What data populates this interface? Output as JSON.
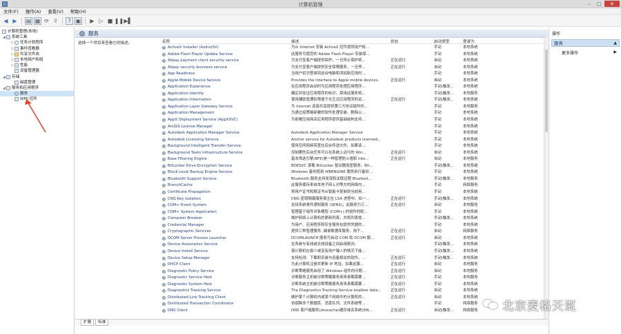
{
  "window": {
    "title": "计算机管理"
  },
  "menu": [
    "文件(F)",
    "操作(A)",
    "查看(V)",
    "帮助(H)"
  ],
  "tree": [
    {
      "label": "计算机管理(本地)",
      "level": 0,
      "icon": "computer-icon"
    },
    {
      "label": "系统工具",
      "level": 1,
      "icon": "tools-icon"
    },
    {
      "label": "任务计划程序",
      "level": 2,
      "icon": "clock-icon"
    },
    {
      "label": "事件查看器",
      "level": 2,
      "icon": "event-icon"
    },
    {
      "label": "共享文件夹",
      "level": 2,
      "icon": "folder-icon"
    },
    {
      "label": "本地用户和组",
      "level": 2,
      "icon": "users-icon"
    },
    {
      "label": "性能",
      "level": 2,
      "icon": "performance-icon"
    },
    {
      "label": "设备管理器",
      "level": 2,
      "icon": "device-icon"
    },
    {
      "label": "存储",
      "level": 1,
      "icon": "storage-icon"
    },
    {
      "label": "磁盘管理",
      "level": 2,
      "icon": "disk-icon"
    },
    {
      "label": "服务和应用程序",
      "level": 1,
      "icon": "apps-icon"
    },
    {
      "label": "服务",
      "level": 2,
      "icon": "gear-icon"
    },
    {
      "label": "WMI 控件",
      "level": 2,
      "icon": "wmi-icon"
    }
  ],
  "center": {
    "header": "服务",
    "description": "选择一个项目来查看它的描述。",
    "columns": {
      "name": "名称",
      "desc": "描述",
      "status": "状态",
      "start": "启动类型",
      "login": "登录为"
    },
    "tabs": [
      "扩展",
      "标准"
    ]
  },
  "services": [
    {
      "name": "ActiveX Installer (AxInstSV)",
      "desc": "为从 Internet 安装 ActiveX 控件提供用户帐...",
      "status": "",
      "start": "手动",
      "login": "本地系统"
    },
    {
      "name": "Adobe Flash Player Update Service",
      "desc": "此服务可使您的 Adobe Flash Player 安装保...",
      "status": "",
      "start": "手动",
      "login": "本地系统"
    },
    {
      "name": "Alipay payment client security service",
      "desc": "为支付宝客户端提供保护，一旦停止保护将...",
      "status": "正在运行",
      "start": "自动",
      "login": "本地系统"
    },
    {
      "name": "Alipay security business service",
      "desc": "为支付宝客户端提供安全保障服务，一旦停...",
      "status": "正在运行",
      "start": "自动",
      "login": "本地系统"
    },
    {
      "name": "App Readiness",
      "desc": "当用户初次登录到这台电脑和添加新应用时...",
      "status": "",
      "start": "手动",
      "login": "本地系统"
    },
    {
      "name": "Apple Mobile Device Service",
      "desc": "Provides the interface to Apple mobile devices.",
      "status": "正在运行",
      "start": "自动",
      "login": "本地系统"
    },
    {
      "name": "Application Experience",
      "desc": "在应用程序启动时为应用程序处理应用程序...",
      "status": "",
      "start": "手动(触发...",
      "login": "本地系统"
    },
    {
      "name": "Application Identity",
      "desc": "确定并验证应用程序的标识。禁用此服务将...",
      "status": "",
      "start": "手动(触发...",
      "login": "本地服务"
    },
    {
      "name": "Application Information",
      "desc": "使用辅助管理权限便于交互式应用程序的运...",
      "status": "正在运行",
      "start": "手动(触发...",
      "login": "本地系统"
    },
    {
      "name": "Application Layer Gateway Service",
      "desc": "为 Internet 连接共享提供第三方协议插件的...",
      "status": "",
      "start": "手动",
      "login": "本地服务"
    },
    {
      "name": "Application Management",
      "desc": "为通过组策略部署的软件处理安装、删除以...",
      "status": "",
      "start": "手动",
      "login": "本地系统"
    },
    {
      "name": "AppX Deployment Service (AppXSVC)",
      "desc": "为部署应用商店应用程序提供基础结构支持...",
      "status": "",
      "start": "手动",
      "login": "本地系统"
    },
    {
      "name": "ArcGIS License Manager",
      "desc": "",
      "status": "",
      "start": "手动",
      "login": "本地系统"
    },
    {
      "name": "Autodesk Application Manager Service",
      "desc": "Autodesk Application Manager Service",
      "status": "",
      "start": "手动",
      "login": "本地系统"
    },
    {
      "name": "Autodesk Licensing Service",
      "desc": "Anchor service for Autodesk products licensed...",
      "status": "",
      "start": "手动",
      "login": "本地系统"
    },
    {
      "name": "Background Intelligent Transfer Service",
      "desc": "使用空闲网络带宽在后台传送文件。如果该...",
      "status": "",
      "start": "手动",
      "login": "本地系统"
    },
    {
      "name": "Background Tasks Infrastructure Service",
      "desc": "控制哪些后台任务可以在系统上运行的 Win...",
      "status": "正在运行",
      "start": "自动",
      "login": "本地系统"
    },
    {
      "name": "Base Filtering Engine",
      "desc": "基本筛选引擎(BFE)是一种管理防火墙和 Inte...",
      "status": "正在运行",
      "start": "自动",
      "login": "本地服务"
    },
    {
      "name": "BitLocker Drive Encryption Service",
      "desc": "BDESVC 承载 BitLocker 驱动器加密服务。Bit...",
      "status": "",
      "start": "手动(触发...",
      "login": "本地系统"
    },
    {
      "name": "Block Level Backup Engine Service",
      "desc": "Windows 备份使用 WBENGINE 服务执行备份...",
      "status": "",
      "start": "手动",
      "login": "本地系统"
    },
    {
      "name": "Bluetooth Support Service",
      "desc": "Bluetooth 服务支持发现和关联远程 Bluetoot...",
      "status": "",
      "start": "手动(触发...",
      "login": "本地服务"
    },
    {
      "name": "BranchCache",
      "desc": "此服务缓存来自本地子网上对等方的网络内...",
      "status": "",
      "start": "手动",
      "login": "网络服务"
    },
    {
      "name": "Certificate Propagation",
      "desc": "将用户证书和根证书从智能卡复制到当前用...",
      "status": "",
      "start": "手动",
      "login": "本地系统"
    },
    {
      "name": "CNG Key Isolation",
      "desc": "CNG 密钥隔离服务宿主在 LSA 进程中。如一...",
      "status": "正在运行",
      "start": "手动(触发...",
      "login": "本地系统"
    },
    {
      "name": "COM+ Event System",
      "desc": "支持系统事件通知服务 (SENS)，此服务为订...",
      "status": "正在运行",
      "start": "自动",
      "login": "本地服务"
    },
    {
      "name": "COM+ System Application",
      "desc": "管理基于组件对象模型 (COM+) 的组件的配...",
      "status": "",
      "start": "手动",
      "login": "本地系统"
    },
    {
      "name": "Computer Browser",
      "desc": "维护网络上计算机的更新列表，并将列表提...",
      "status": "",
      "start": "手动(触发...",
      "login": "本地系统"
    },
    {
      "name": "Credential Manager",
      "desc": "为用户、应用程序和安全服务包提供凭据的...",
      "status": "",
      "start": "手动",
      "login": "本地系统"
    },
    {
      "name": "Cryptographic Services",
      "desc": "提供三种管理服务: 编录数据库服务，用于...",
      "status": "正在运行",
      "start": "自动",
      "login": "网络服务"
    },
    {
      "name": "DCOM Server Process Launcher",
      "desc": "DCOMLAUNCH 服务可启动 COM 和 DCOM 服...",
      "status": "正在运行",
      "start": "自动",
      "login": "本地系统"
    },
    {
      "name": "Device Association Service",
      "desc": "在系统与有线或无线设备之间启用配对。",
      "status": "",
      "start": "手动(触发...",
      "login": "本地系统"
    },
    {
      "name": "Device Install Service",
      "desc": "使计算机在极少或没有用户输入的情况下能...",
      "status": "",
      "start": "手动(触发...",
      "login": "本地系统"
    },
    {
      "name": "Device Setup Manager",
      "desc": "支持检测、下载和安装与设备相关的软件。...",
      "status": "正在运行",
      "start": "手动(触发...",
      "login": "本地系统"
    },
    {
      "name": "DHCP Client",
      "desc": "为此计算机注册并更新 IP 地址。如果此服...",
      "status": "正在运行",
      "start": "自动",
      "login": "本地服务"
    },
    {
      "name": "Diagnostic Policy Service",
      "desc": "诊断策略服务启用了 Windows 组件的问题...",
      "status": "正在运行",
      "start": "自动",
      "login": "本地服务"
    },
    {
      "name": "Diagnostic Service Host",
      "desc": "诊断服务主机被诊断策略服务用来承载需要...",
      "status": "正在运行",
      "start": "手动",
      "login": "本地服务"
    },
    {
      "name": "Diagnostic System Host",
      "desc": "诊断系统主机被诊断策略服务用来承载需要...",
      "status": "正在运行",
      "start": "手动",
      "login": "本地系统"
    },
    {
      "name": "Diagnostics Tracking Service",
      "desc": "The Diagnostics Tracking Service enables data...",
      "status": "正在运行",
      "start": "自动",
      "login": "本地系统"
    },
    {
      "name": "Distributed Link Tracking Client",
      "desc": "维护某个计算机内或某个网络中的计算机的...",
      "status": "正在运行",
      "start": "自动",
      "login": "本地系统"
    },
    {
      "name": "Distributed Transaction Coordinator",
      "desc": "协调跨多个数据库、消息队列、文件系统等...",
      "status": "",
      "start": "手动",
      "login": "网络服务"
    },
    {
      "name": "DNS Client",
      "desc": "DNS 客户端服务(dnscache)缓存域名系统(DN...",
      "status": "正在运行",
      "start": "自动(触发...",
      "login": "网络服务"
    }
  ],
  "right": {
    "title": "操作",
    "section": "服务",
    "more": "更多操作"
  },
  "watermark": "北京麦格天渱"
}
